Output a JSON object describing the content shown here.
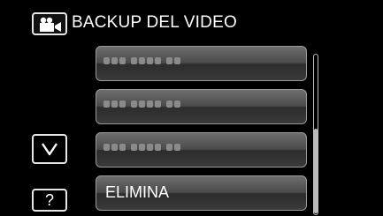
{
  "header": {
    "mode_icon": "video-camera-icon",
    "title": "BACKUP DEL VIDEO"
  },
  "list": {
    "items": [
      {
        "state": "greyed-out placeholder"
      },
      {
        "state": "greyed-out placeholder"
      },
      {
        "state": "greyed-out placeholder"
      }
    ],
    "delete_label": "ELIMINA"
  },
  "controls": {
    "down_icon": "chevron-down-icon",
    "help_label": "?"
  },
  "colors": {
    "background": "#000000",
    "button_border": "#9a9a9a",
    "text": "#ffffff",
    "placeholder_dots": "#8a8a8a"
  }
}
